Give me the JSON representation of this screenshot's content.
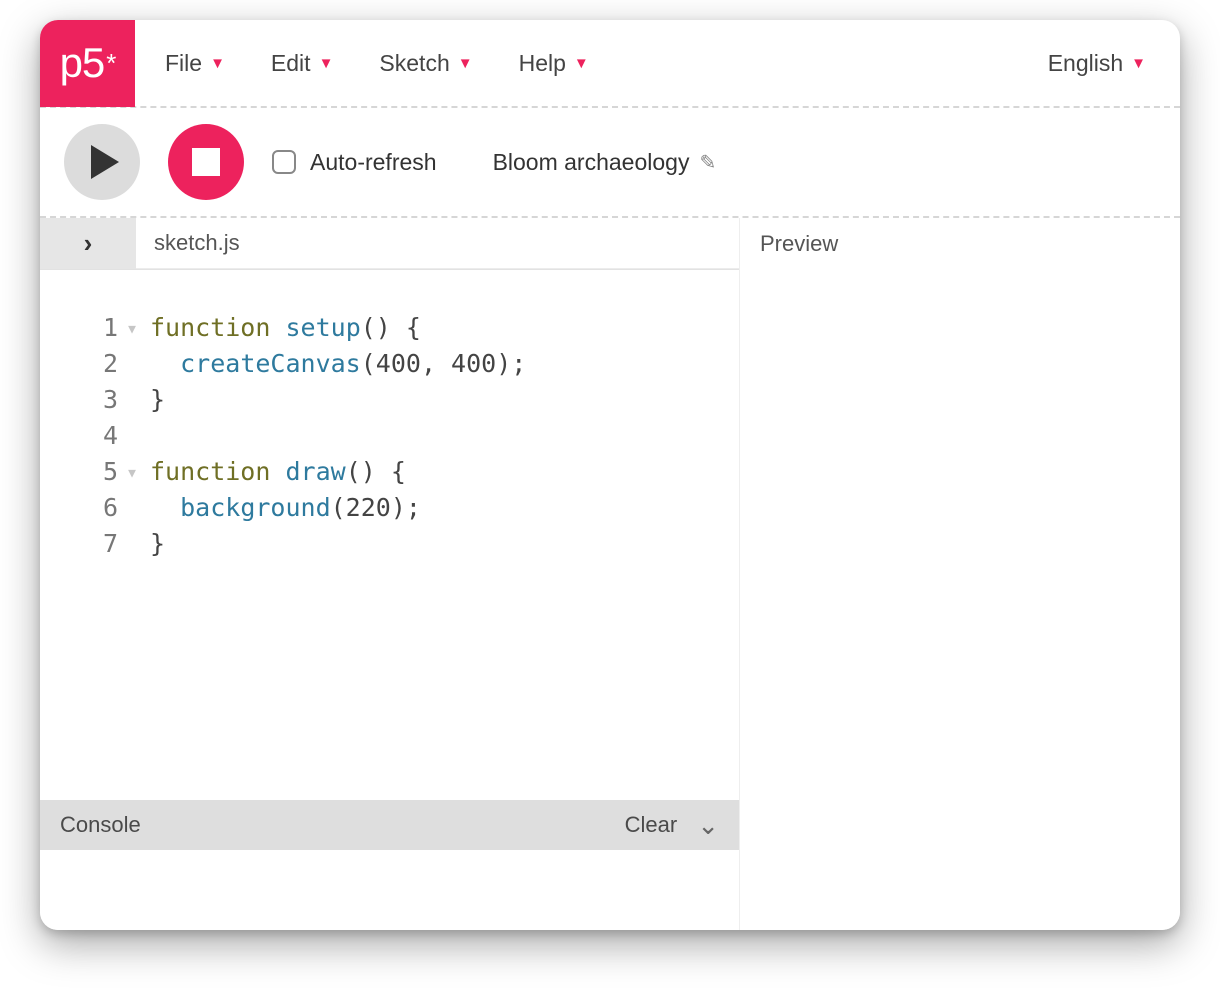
{
  "brand": {
    "logo_text": "p5",
    "logo_star": "*"
  },
  "menu": {
    "file": "File",
    "edit": "Edit",
    "sketch": "Sketch",
    "help": "Help"
  },
  "language": {
    "label": "English"
  },
  "toolbar": {
    "auto_refresh_label": "Auto-refresh",
    "auto_refresh_checked": false,
    "sketch_name": "Bloom archaeology"
  },
  "editor": {
    "file_tab": "sketch.js",
    "lines": [
      {
        "n": "1",
        "fold": "▾"
      },
      {
        "n": "2",
        "fold": ""
      },
      {
        "n": "3",
        "fold": ""
      },
      {
        "n": "4",
        "fold": ""
      },
      {
        "n": "5",
        "fold": "▾"
      },
      {
        "n": "6",
        "fold": ""
      },
      {
        "n": "7",
        "fold": ""
      }
    ],
    "code_tokens": {
      "l1_kw": "function",
      "l1_fn": "setup",
      "l1_rest": "() {",
      "l2_fn": "createCanvas",
      "l2_rest": "(400, 400);",
      "l3": "}",
      "l4": "",
      "l5_kw": "function",
      "l5_fn": "draw",
      "l5_rest": "() {",
      "l6_fn": "background",
      "l6_rest": "(220);",
      "l7": "}"
    }
  },
  "console": {
    "label": "Console",
    "clear_label": "Clear"
  },
  "preview": {
    "label": "Preview"
  }
}
